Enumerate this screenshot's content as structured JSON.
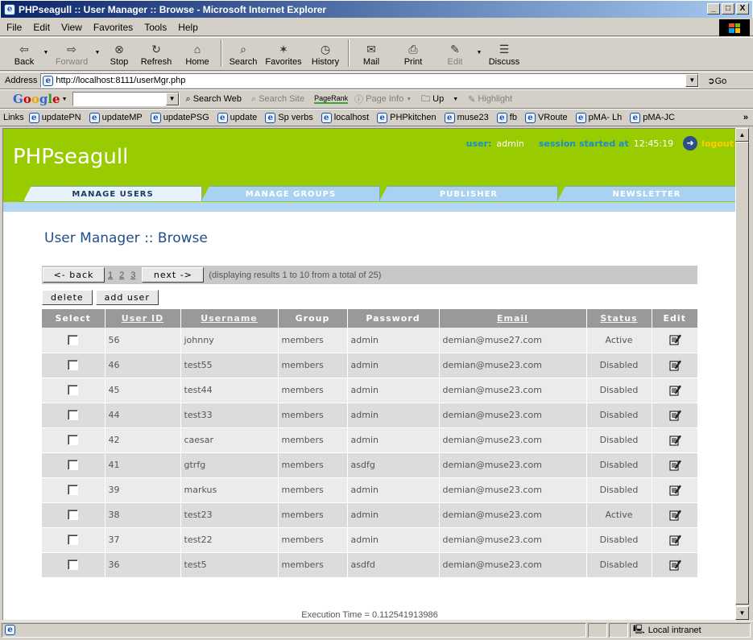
{
  "window": {
    "title": "PHPseagull :: User Manager :: Browse - Microsoft Internet Explorer",
    "min": "_",
    "max": "□",
    "close": "X"
  },
  "menu": [
    "File",
    "Edit",
    "View",
    "Favorites",
    "Tools",
    "Help"
  ],
  "toolbar": [
    {
      "label": "Back",
      "icon": "⇦",
      "name": "back",
      "enabled": true
    },
    {
      "label": "Forward",
      "icon": "⇨",
      "name": "forward",
      "enabled": false
    },
    {
      "label": "Stop",
      "icon": "⊗",
      "name": "stop",
      "enabled": true
    },
    {
      "label": "Refresh",
      "icon": "↻",
      "name": "refresh",
      "enabled": true
    },
    {
      "label": "Home",
      "icon": "⌂",
      "name": "home",
      "enabled": true
    },
    {
      "label": "Search",
      "icon": "⌕",
      "name": "search",
      "enabled": true
    },
    {
      "label": "Favorites",
      "icon": "✶",
      "name": "favorites",
      "enabled": true
    },
    {
      "label": "History",
      "icon": "◷",
      "name": "history",
      "enabled": true
    },
    {
      "label": "Mail",
      "icon": "✉",
      "name": "mail",
      "enabled": true
    },
    {
      "label": "Print",
      "icon": "⎙",
      "name": "print",
      "enabled": true
    },
    {
      "label": "Edit",
      "icon": "✎",
      "name": "edit",
      "enabled": false
    },
    {
      "label": "Discuss",
      "icon": "☰",
      "name": "discuss",
      "enabled": true
    }
  ],
  "address": {
    "label": "Address",
    "url": "http://localhost:8111/userMgr.php",
    "go": "Go"
  },
  "googlebar": {
    "logo": [
      "G",
      "o",
      "o",
      "g",
      "l",
      "e"
    ],
    "search_web": "Search Web",
    "search_site": "Search Site",
    "pagerank": "PageRank",
    "page_info": "Page Info",
    "up": "Up",
    "highlight": "Highlight"
  },
  "links": {
    "label": "Links",
    "items": [
      "updatePN",
      "updateMP",
      "updatePSG",
      "update",
      "Sp verbs",
      "localhost",
      "PHPkitchen",
      "muse23",
      "fb",
      "VRoute",
      "pMA- Lh",
      "pMA-JC"
    ],
    "more": "»"
  },
  "site": {
    "logo": "PHPseagull",
    "user_label": "user:",
    "user_value": "admin",
    "session_label": "session started at",
    "session_value": "12:45:19",
    "logout": "logout",
    "tabs": [
      "MANAGE USERS",
      "MANAGE GROUPS",
      "PUBLISHER",
      "NEWSLETTER"
    ],
    "active_tab": 0
  },
  "page": {
    "title": "User Manager :: Browse",
    "back_label": "<-  back",
    "next_label": "next  ->",
    "pages": [
      "1",
      "2",
      "3"
    ],
    "results_info": "(displaying results 1 to 10 from a total of 25)",
    "delete_label": "delete",
    "add_user_label": "add user",
    "execution_time": "Execution Time = 0.112541913986"
  },
  "table": {
    "headers": [
      "Select",
      "User ID",
      "Username",
      "Group",
      "Password",
      "Email",
      "Status",
      "Edit"
    ],
    "rows": [
      {
        "id": "56",
        "username": "johnny",
        "group": "members",
        "password": "admin",
        "email": "demian@muse27.com",
        "status": "Active"
      },
      {
        "id": "46",
        "username": "test55",
        "group": "members",
        "password": "admin",
        "email": "demian@muse23.com",
        "status": "Disabled"
      },
      {
        "id": "45",
        "username": "test44",
        "group": "members",
        "password": "admin",
        "email": "demian@muse23.com",
        "status": "Disabled"
      },
      {
        "id": "44",
        "username": "test33",
        "group": "members",
        "password": "admin",
        "email": "demian@muse23.com",
        "status": "Disabled"
      },
      {
        "id": "42",
        "username": "caesar",
        "group": "members",
        "password": "admin",
        "email": "demian@muse23.com",
        "status": "Disabled"
      },
      {
        "id": "41",
        "username": "gtrfg",
        "group": "members",
        "password": "asdfg",
        "email": "demian@muse23.com",
        "status": "Disabled"
      },
      {
        "id": "39",
        "username": "markus",
        "group": "members",
        "password": "admin",
        "email": "demian@muse23.com",
        "status": "Disabled"
      },
      {
        "id": "38",
        "username": "test23",
        "group": "members",
        "password": "admin",
        "email": "demian@muse23.com",
        "status": "Active"
      },
      {
        "id": "37",
        "username": "test22",
        "group": "members",
        "password": "admin",
        "email": "demian@muse23.com",
        "status": "Disabled"
      },
      {
        "id": "36",
        "username": "test5",
        "group": "members",
        "password": "asdfd",
        "email": "demian@muse23.com",
        "status": "Disabled"
      }
    ]
  },
  "status": {
    "zone": "Local intranet"
  },
  "colors": {
    "header_green": "#99cc00",
    "tab_blue": "#a9d2f2",
    "title_blue": "#1f5089",
    "user_label": "#1b8ec4",
    "logout": "#ffcc00"
  }
}
